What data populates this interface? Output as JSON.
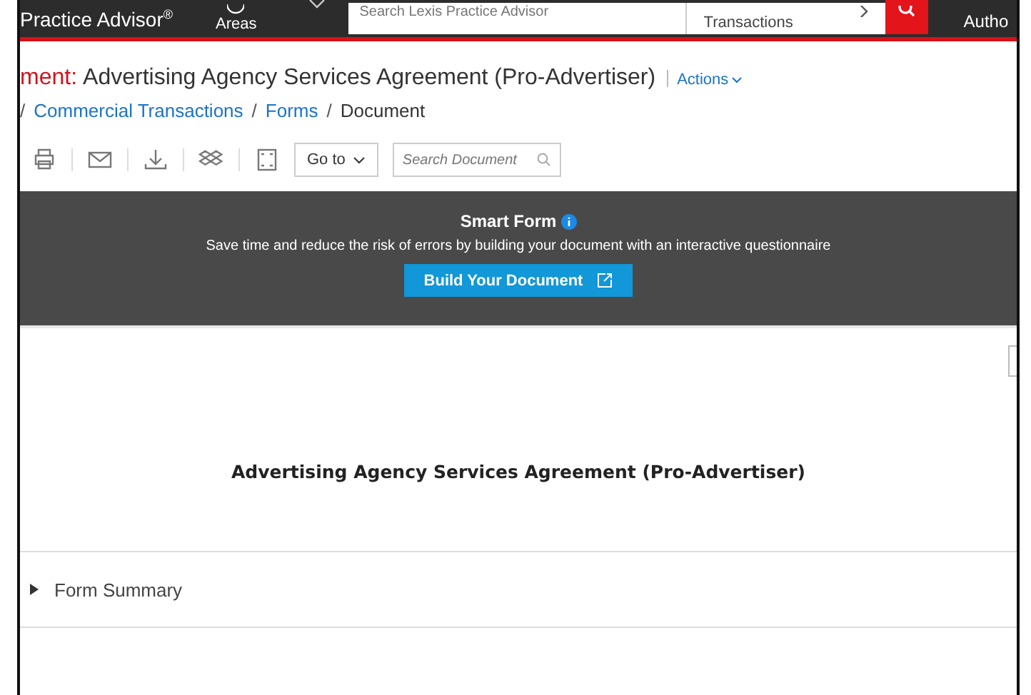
{
  "top_bar": {
    "brand": "Practice Advisor$^{®}$",
    "areas_label": "Areas",
    "search": {
      "placeholder": "Search Lexis Practice Advisor"
    },
    "scope": "Transactions",
    "user": "Autho"
  },
  "header": {
    "title_prefix": "ment:",
    "title": "Advertising Agency Services Agreement (Pro-Advertiser)",
    "actions": "Actions"
  },
  "breadcrumb": [
    {
      "separator": "/",
      "label": "Commercial Transactions",
      "link": true
    },
    {
      "separator": "/",
      "label": "Forms",
      "link": true
    },
    {
      "separator": "/",
      "label": "Document",
      "link": false
    }
  ],
  "toolbar": {
    "goto": "Go to",
    "search": {
      "placeholder": "Search Document"
    }
  },
  "smart_form": {
    "title": "Smart Form",
    "text": "Save time and reduce the risk of errors by building your document with an interactive questionnaire",
    "button": "Build Your Document"
  },
  "document": {
    "title": "Advertising Agency Services Agreement (Pro-Advertiser)",
    "sections": [
      {
        "label": "Form Summary",
        "expanded": false
      }
    ]
  }
}
